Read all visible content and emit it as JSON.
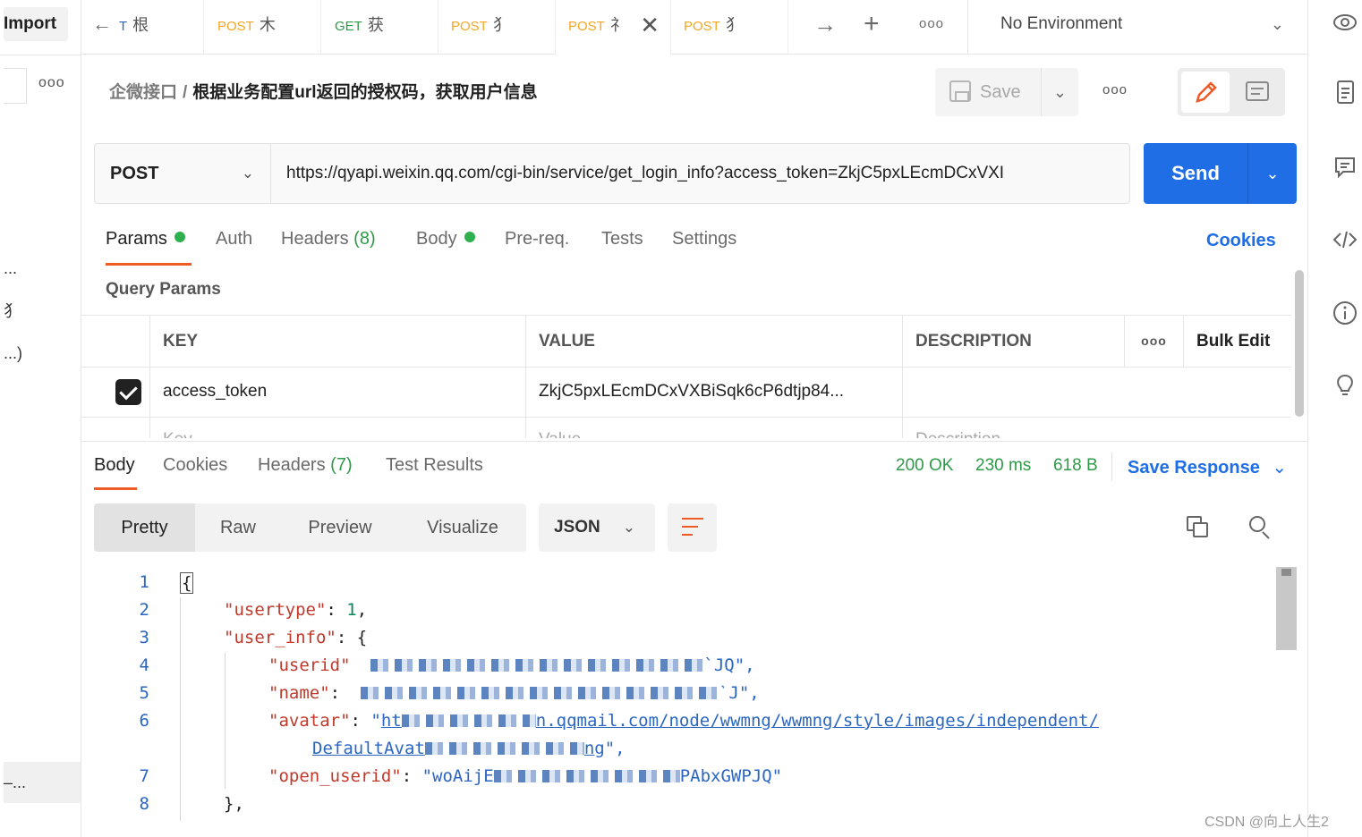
{
  "sidebar": {
    "import_label": "Import",
    "more_label": "ooo",
    "items": [
      {
        "label": "..."
      },
      {
        "label": "犭"
      },
      {
        "label": "...)"
      },
      {
        "label": "–..."
      }
    ]
  },
  "tabs": {
    "back_label": "←",
    "items": [
      {
        "method": "T",
        "name": "根"
      },
      {
        "method": "POST",
        "name": "木"
      },
      {
        "method": "GET",
        "name": "获"
      },
      {
        "method": "POST",
        "name": "犭"
      },
      {
        "method": "POST",
        "name": "礻"
      },
      {
        "method": "POST",
        "name": "犭"
      }
    ],
    "close_label": "✕",
    "forward_label": "→",
    "new_label": "+",
    "more_label": "ooo",
    "environment": "No Environment"
  },
  "request": {
    "breadcrumb_parent": "企微接口",
    "breadcrumb_sep": "/",
    "breadcrumb_current": "根据业务配置url返回的授权码，获取用户信息",
    "save_label": "Save",
    "method": "POST",
    "url": "https://qyapi.weixin.qq.com/cgi-bin/service/get_login_info?access_token=ZkjC5pxLEcmDCxVXI",
    "send_label": "Send",
    "tabs": {
      "params": "Params",
      "auth": "Auth",
      "headers": "Headers",
      "headers_count": "(8)",
      "body": "Body",
      "prereq": "Pre-req.",
      "tests": "Tests",
      "settings": "Settings"
    },
    "cookies_label": "Cookies",
    "query_params_title": "Query Params",
    "params_table": {
      "headers": {
        "key": "KEY",
        "value": "VALUE",
        "description": "DESCRIPTION",
        "more": "ooo",
        "bulk_edit": "Bulk Edit"
      },
      "rows": [
        {
          "key": "access_token",
          "value": "ZkjC5pxLEcmDCxVXBiSqk6cP6dtjp84...",
          "description": ""
        }
      ],
      "placeholder": {
        "key": "Key",
        "value": "Value",
        "description": "Description"
      }
    }
  },
  "response": {
    "tabs": {
      "body": "Body",
      "cookies": "Cookies",
      "headers": "Headers",
      "headers_count": "(7)",
      "test_results": "Test Results"
    },
    "status": "200 OK",
    "time": "230 ms",
    "size": "618 B",
    "save_response_label": "Save Response",
    "views": [
      "Pretty",
      "Raw",
      "Preview",
      "Visualize"
    ],
    "format": "JSON",
    "line_numbers": [
      "1",
      "2",
      "3",
      "4",
      "5",
      "6",
      "",
      "7",
      "8"
    ],
    "code": {
      "l1": "{",
      "l2_key": "\"usertype\"",
      "l2_sep": ": ",
      "l2_val": "1",
      "l2_end": ",",
      "l3_key": "\"user_info\"",
      "l3_sep": ": {",
      "l4_key": "\"userid\"",
      "l4_tail": "`JQ\",",
      "l5_key": "\"name\"",
      "l5_sep": ":",
      "l5_tail": "ˋJ\",",
      "l6_key": "\"avatar\"",
      "l6_sep": ": ",
      "l6_q": "\"",
      "l6_start": "ht",
      "l6_rest": "n.qqmail.com/node/wwmng/wwmng/style/images/independent/",
      "l6b_start": "DefaultAvat",
      "l6b_rest": "ng",
      "l6b_end": "\",",
      "l7_key": "\"open_userid\"",
      "l7_sep": ": ",
      "l7_start": "\"woAijE",
      "l7_tail": "PAbxGWPJQ\"",
      "l8": "},"
    }
  },
  "watermark": "CSDN @向上人生2"
}
